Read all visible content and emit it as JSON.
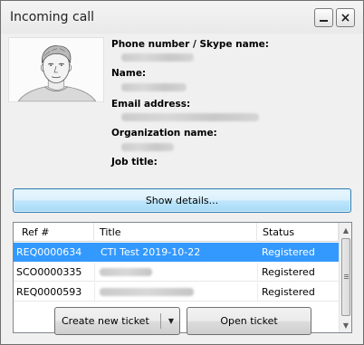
{
  "window": {
    "title": "Incoming call",
    "minimize_glyph": "minimize-icon",
    "close_glyph": "×"
  },
  "contact": {
    "photo_icon": "contact-photo",
    "phone_label": "Phone number / Skype name:",
    "name_label": "Name:",
    "email_label": "Email address:",
    "organization_label": "Organization name:",
    "job_title_label": "Job title:"
  },
  "actions": {
    "show_details": "Show details...",
    "create_ticket": "Create new ticket",
    "create_ticket_arrow": "▼",
    "open_ticket": "Open ticket"
  },
  "tickets": {
    "columns": [
      "Ref #",
      "Title",
      "Status"
    ],
    "rows": [
      {
        "ref": "REQ0000634",
        "title": "CTI Test 2019-10-22",
        "status": "Registered",
        "selected": true
      },
      {
        "ref": "SCO0000335",
        "title": "",
        "status": "Registered",
        "selected": false
      },
      {
        "ref": "REQ0000593",
        "title": "",
        "status": "Registered",
        "selected": false
      }
    ]
  },
  "scrollbar": {
    "up_arrow": "▲",
    "down_arrow": "▼"
  }
}
